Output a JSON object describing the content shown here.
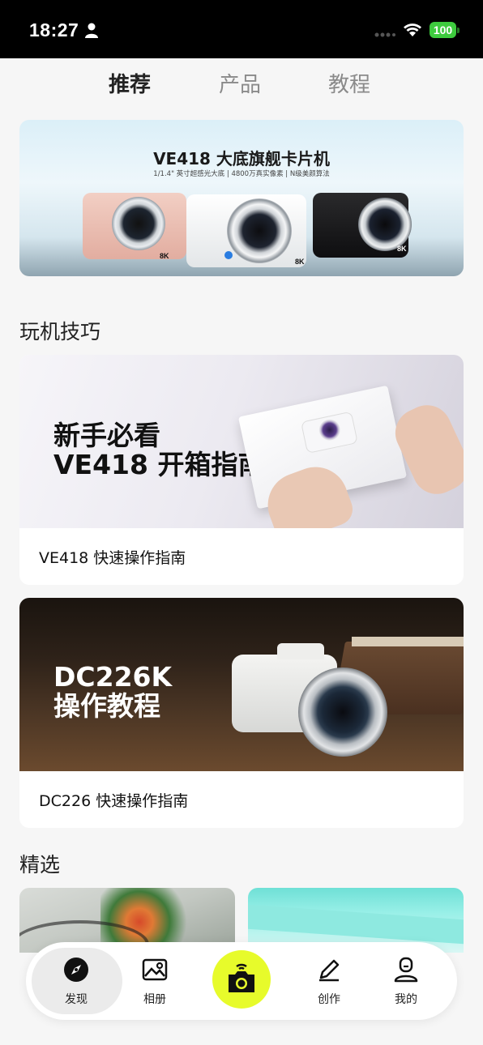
{
  "status_bar": {
    "time": "18:27",
    "battery": "100"
  },
  "tabs": [
    {
      "label": "推荐",
      "active": true
    },
    {
      "label": "产品",
      "active": false
    },
    {
      "label": "教程",
      "active": false
    }
  ],
  "banner": {
    "title": "VE418  大底旗舰卡片机",
    "subtitle": "1/1.4\" 英寸超感光大底 | 4800万真实像素 | N级美颜算法",
    "camera_badge": "8K"
  },
  "sections": {
    "tips_title": "玩机技巧",
    "featured_title": "精选"
  },
  "tutorials": [
    {
      "image_line1": "新手必看",
      "image_line2": "VE418 开箱指南",
      "caption": "VE418 快速操作指南"
    },
    {
      "image_line1": "DC226K",
      "image_line2": "操作教程",
      "caption": "DC226 快速操作指南"
    }
  ],
  "nav": {
    "discover": "发现",
    "album": "相册",
    "create": "创作",
    "mine": "我的"
  },
  "colors": {
    "accent": "#e7fb2b",
    "battery": "#3ecb3e"
  },
  "icons": [
    "person-icon",
    "wifi-icon",
    "battery-icon",
    "compass-icon",
    "album-icon",
    "camera-icon",
    "pencil-icon",
    "profile-icon"
  ]
}
